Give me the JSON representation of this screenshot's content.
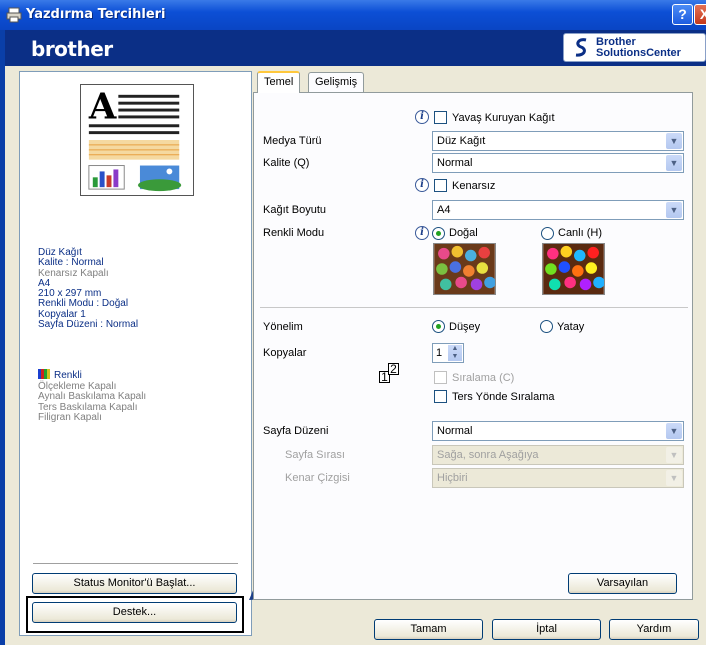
{
  "window": {
    "title": "Yazdırma Tercihleri",
    "help_btn": "?",
    "close_btn": "X"
  },
  "brand": {
    "logo": "brother",
    "solutions_line1": "Brother",
    "solutions_line2": "SolutionsCenter"
  },
  "tabs": [
    {
      "label": "Temel",
      "active": true
    },
    {
      "label": "Gelişmiş",
      "active": false
    }
  ],
  "summary": {
    "lines": [
      "Düz Kağıt",
      "Kalite : Normal"
    ],
    "gray_lines": [
      "Kenarsız Kapalı"
    ],
    "lines2": [
      "A4",
      "210 x 297 mm",
      "Renkli Modu : Doğal",
      "Kopyalar 1",
      "Sayfa Düzeni : Normal"
    ],
    "renkli": "Renkli",
    "extras": [
      "Ölçekleme Kapalı",
      "Aynalı Baskılama Kapalı",
      "Ters Baskılama Kapalı",
      "Filigran Kapalı"
    ]
  },
  "left_buttons": {
    "status_monitor": "Status Monitor'ü Başlat...",
    "support": "Destek..."
  },
  "form": {
    "slow_drying": "Yavaş Kuruyan Kağıt",
    "media_type_label": "Medya Türü",
    "media_type_value": "Düz Kağıt",
    "quality_label": "Kalite (Q)",
    "quality_value": "Normal",
    "borderless": "Kenarsız",
    "paper_size_label": "Kağıt Boyutu",
    "paper_size_value": "A4",
    "color_mode_label": "Renkli Modu",
    "color_mode_natural": "Doğal",
    "color_mode_vivid": "Canlı (H)",
    "orientation_label": "Yönelim",
    "orientation_portrait": "Düşey",
    "orientation_landscape": "Yatay",
    "copies_label": "Kopyalar",
    "copies_value": "1",
    "collate": "Sıralama (C)",
    "reverse_order": "Ters Yönde Sıralama",
    "page_layout_label": "Sayfa Düzeni",
    "page_layout_value": "Normal",
    "page_order_label": "Sayfa Sırası",
    "page_order_value": "Sağa, sonra Aşağıya",
    "border_line_label": "Kenar Çizgisi",
    "border_line_value": "Hiçbiri",
    "defaults_btn": "Varsayılan"
  },
  "bottom_buttons": {
    "ok": "Tamam",
    "cancel": "İptal",
    "help": "Yardım"
  },
  "collate_icon": {
    "a": "1",
    "b": "2"
  },
  "colors": {
    "title_blue": "#0a45c4",
    "brand_blue": "#0b2f86",
    "dialog_bg": "#ece9d8",
    "summary_text": "#0b2f86"
  }
}
